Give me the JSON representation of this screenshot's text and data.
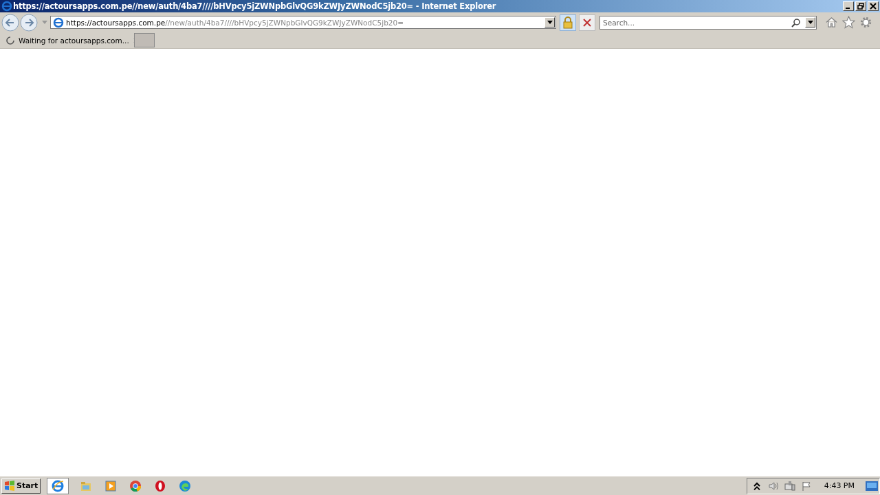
{
  "window": {
    "title": "https://actoursapps.com.pe//new/auth/4ba7////bHVpcy5jZWNpbGlvQG9kZWJyZWNodC5jb20= - Internet Explorer"
  },
  "address_bar": {
    "host": "https://actoursapps.com.pe",
    "path": "//new/auth/4ba7////bHVpcy5jZWNpbGlvQG9kZWJyZWNodC5jb20="
  },
  "search": {
    "placeholder": "Search..."
  },
  "tabs": [
    {
      "label": "Waiting for actoursapps.com...",
      "loading": true,
      "selected": true
    }
  ],
  "taskbar": {
    "start": "Start",
    "apps": [
      {
        "kind": "ie",
        "selected": true
      },
      {
        "kind": "folder",
        "selected": false
      },
      {
        "kind": "media",
        "selected": false
      },
      {
        "kind": "chrome",
        "selected": false
      },
      {
        "kind": "opera",
        "selected": false
      },
      {
        "kind": "edge",
        "selected": false
      }
    ],
    "clock": "4:43 PM"
  }
}
